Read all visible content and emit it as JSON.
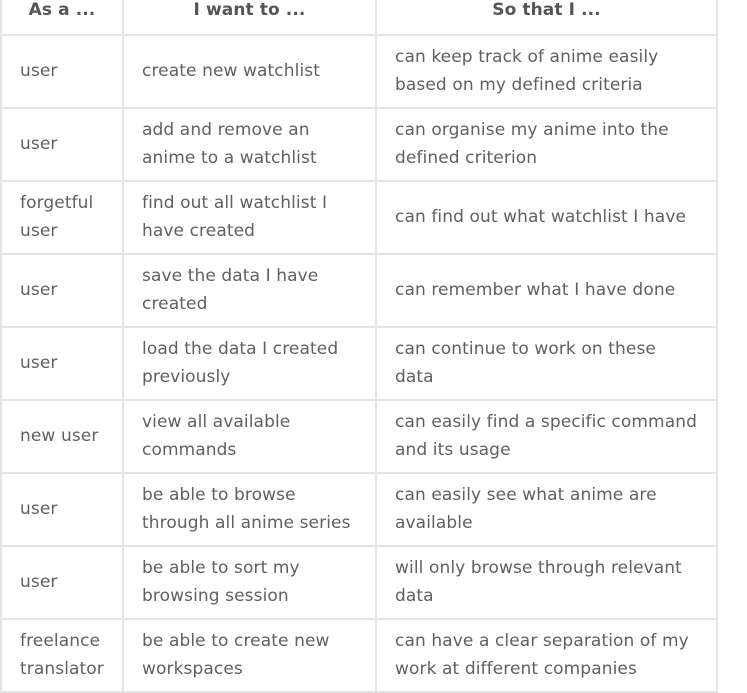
{
  "table": {
    "headers": [
      "As a ...",
      "I want to ...",
      "So that I ..."
    ],
    "rows": [
      {
        "role": "user",
        "want": "create new watchlist",
        "benefit": "can keep track of anime easily based on my defined criteria"
      },
      {
        "role": "user",
        "want": "add and remove an anime to a watchlist",
        "benefit": "can organise my anime into the defined criterion"
      },
      {
        "role": "forgetful user",
        "want": "find out all watchlist I have created",
        "benefit": "can find out what watchlist I have"
      },
      {
        "role": "user",
        "want": "save the data I have created",
        "benefit": "can remember what I have done"
      },
      {
        "role": "user",
        "want": "load the data I created previously",
        "benefit": "can continue to work on these data"
      },
      {
        "role": "new user",
        "want": "view all available commands",
        "benefit": "can easily find a specific command and its usage"
      },
      {
        "role": "user",
        "want": "be able to browse through all anime series",
        "benefit": "can easily see what anime are available"
      },
      {
        "role": "user",
        "want": "be able to sort my browsing session",
        "benefit": "will only browse through relevant data"
      },
      {
        "role": "freelance translator",
        "want": "be able to create new workspaces",
        "benefit": "can have a clear separation of my work at different companies"
      }
    ]
  }
}
